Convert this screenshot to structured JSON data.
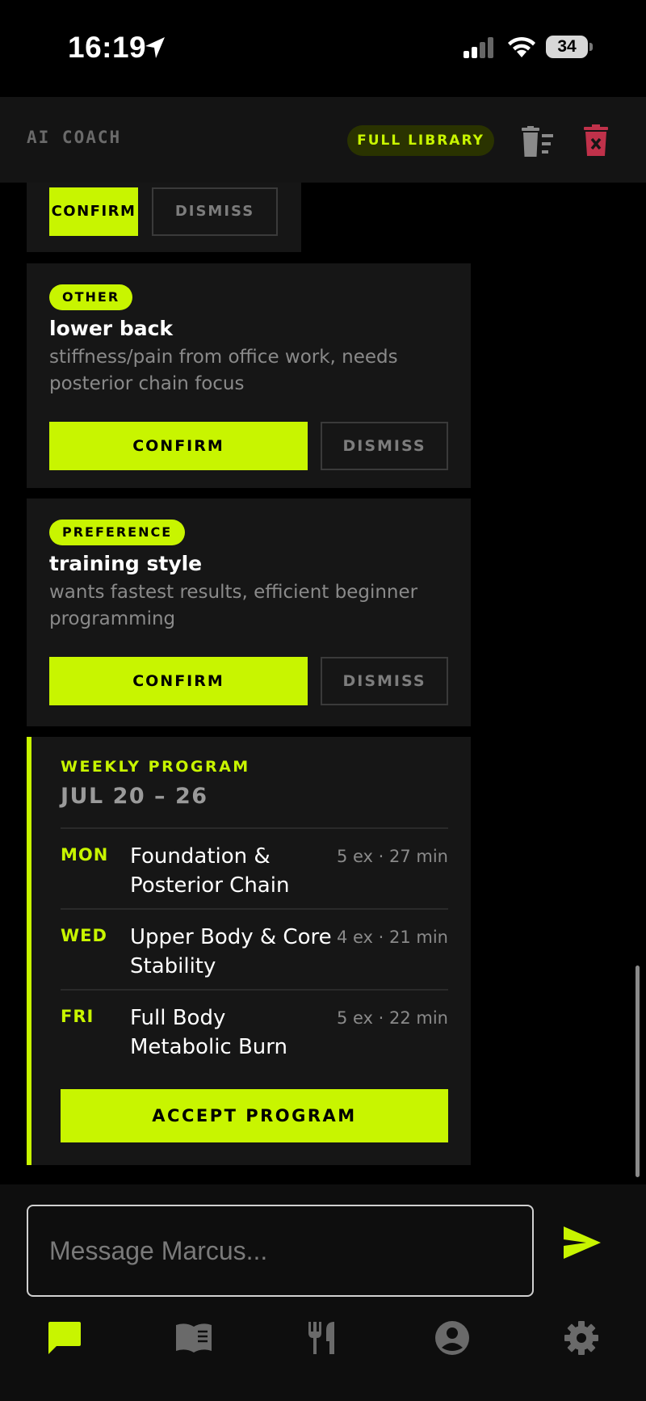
{
  "status": {
    "time": "16:19",
    "battery": "34"
  },
  "header": {
    "title": "AI COACH",
    "library_label": "FULL LIBRARY"
  },
  "top_card": {
    "confirm_label": "CONFIRM",
    "dismiss_label": "DISMISS"
  },
  "memories": [
    {
      "tag": "OTHER",
      "title": "lower back",
      "desc": "stiffness/pain from office work, needs posterior chain focus",
      "confirm_label": "CONFIRM",
      "dismiss_label": "DISMISS"
    },
    {
      "tag": "PREFERENCE",
      "title": "training style",
      "desc": "wants fastest results, efficient beginner programming",
      "confirm_label": "CONFIRM",
      "dismiss_label": "DISMISS"
    }
  ],
  "program": {
    "label": "WEEKLY PROGRAM",
    "range": "JUL 20 – 26",
    "days": [
      {
        "day": "MON",
        "title": "Foundation & Posterior Chain",
        "meta": "5 ex · 27 min"
      },
      {
        "day": "WED",
        "title": "Upper Body & Core Stability",
        "meta": "4 ex · 21 min"
      },
      {
        "day": "FRI",
        "title": "Full Body Metabolic Burn",
        "meta": "5 ex · 22 min"
      }
    ],
    "accept_label": "ACCEPT PROGRAM"
  },
  "composer": {
    "placeholder": "Message Marcus...",
    "value": ""
  },
  "tabs": [
    {
      "name": "chat",
      "active": true
    },
    {
      "name": "library",
      "active": false
    },
    {
      "name": "nutrition",
      "active": false
    },
    {
      "name": "profile",
      "active": false
    },
    {
      "name": "settings",
      "active": false
    }
  ],
  "colors": {
    "accent": "#c8f500",
    "danger": "#c0314a",
    "background": "#000000",
    "card": "#161616"
  }
}
